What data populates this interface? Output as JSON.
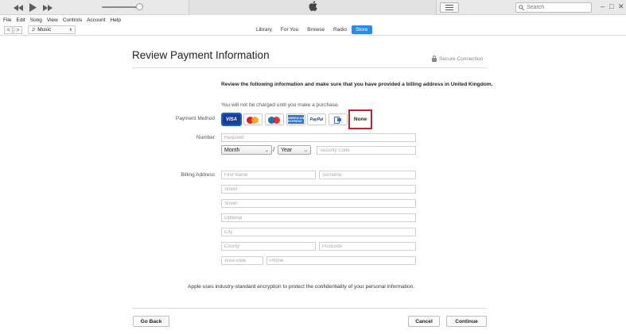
{
  "menu": [
    "File",
    "Edit",
    "Song",
    "View",
    "Controls",
    "Account",
    "Help"
  ],
  "search": {
    "placeholder": "Search"
  },
  "window": {
    "minimize": "–",
    "maximize": "□",
    "close": "✕"
  },
  "nav": {
    "back": "<",
    "forward": ">",
    "media_kind": "Music",
    "tabs": [
      {
        "label": "Library",
        "active": false
      },
      {
        "label": "For You",
        "active": false
      },
      {
        "label": "Browse",
        "active": false
      },
      {
        "label": "Radio",
        "active": false
      },
      {
        "label": "Store",
        "active": true
      }
    ]
  },
  "page": {
    "title": "Review Payment Information",
    "secure": "Secure Connection",
    "intro": "Review the following information and make sure that you have provided a billing address in United Kingdom.",
    "notice": "You will not be charged until you make a purchase.",
    "payment_method_label": "Payment Method",
    "payment_methods": [
      {
        "name": "visa",
        "text": "VISA",
        "selected": true
      },
      {
        "name": "mastercard",
        "text": ""
      },
      {
        "name": "maestro",
        "text": ""
      },
      {
        "name": "amex",
        "text": "AMERICAN EXPRESS"
      },
      {
        "name": "paypal",
        "text": "PayPal"
      },
      {
        "name": "other",
        "text": ""
      }
    ],
    "none_label": "None",
    "number_label": "Number",
    "number_placeholder": "Required",
    "month": "Month",
    "year": "Year",
    "separator": "/",
    "security_code_placeholder": "Security Code",
    "billing_label": "Billing Address",
    "first_name": "First Name",
    "surname": "Surname",
    "street1": "Street",
    "street2": "Street",
    "optional": "Optional",
    "city": "City",
    "county": "County",
    "postcode": "Postcode",
    "area_code": "Area code",
    "phone": "Phone",
    "encryption_note": "Apple uses industry-standard encryption to protect the confidentiality of your personal information.",
    "go_back": "Go Back",
    "cancel": "Cancel",
    "continue": "Continue"
  },
  "colors": {
    "accent": "#2a8be6",
    "highlight": "#c9202d",
    "visa": "#1a3d99"
  }
}
